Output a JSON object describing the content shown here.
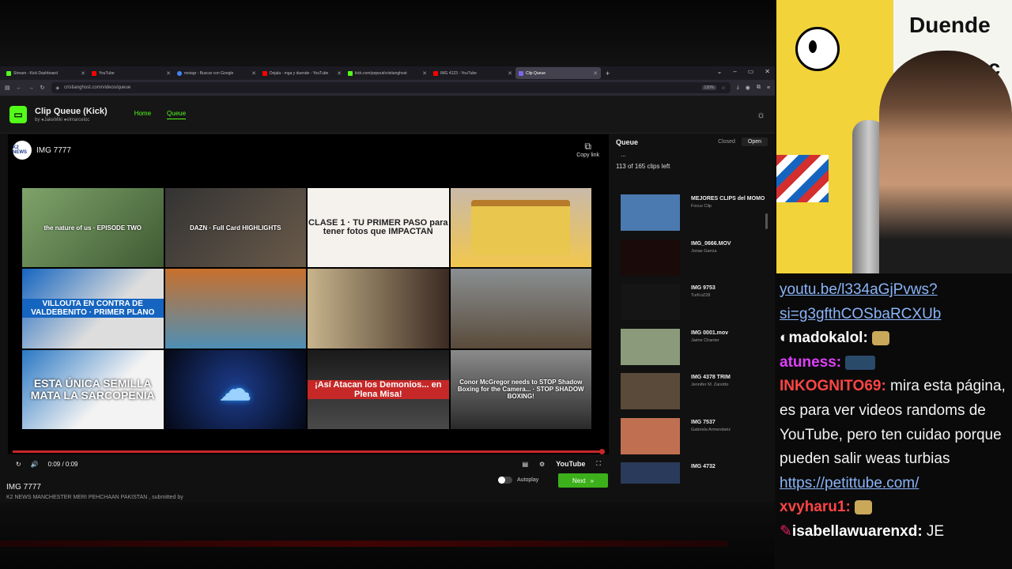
{
  "browser": {
    "tabs": [
      {
        "label": "Stream - Kick Dashboard",
        "color": "#53fc18"
      },
      {
        "label": "YouTube",
        "color": "#ff0000"
      },
      {
        "label": "moiagr - Buscar con Google",
        "color": "#4285f4"
      },
      {
        "label": "Dejala - mga y duende - YouTube",
        "color": "#ff0000"
      },
      {
        "label": "kick.com/popout/cristianghost",
        "color": "#53fc18"
      },
      {
        "label": "IMG 4123 - YouTube",
        "color": "#ff0000"
      },
      {
        "label": "Clip Queue",
        "color": "#7b68ee"
      }
    ],
    "new_tab": "+",
    "url": "cristianghost.com/videos/queue",
    "zoom": "130%"
  },
  "app": {
    "title": "Clip Queue (Kick)",
    "by": "by",
    "author1": "JakeMiki",
    "author2": "elmarceloc",
    "nav_home": "Home",
    "nav_queue": "Queue"
  },
  "player": {
    "channel_logo_text": "K2 NEWS",
    "title": "IMG 7777",
    "copy_link": "Copy link",
    "thumbnails": [
      {
        "text": "the nature of us · EPISODE TWO"
      },
      {
        "text": "DAZN · Full Card HIGHLIGHTS"
      },
      {
        "text": "CLASE 1 · TU PRIMER PASO para tener fotos que IMPACTAN"
      },
      {
        "text": ""
      },
      {
        "text": "VILLOUTA EN CONTRA DE VALDEBENITO · PRIMER PLANO"
      },
      {
        "text": ""
      },
      {
        "text": ""
      },
      {
        "text": ""
      },
      {
        "text": "ESTA ÚNICA SEMILLA MATA LA SARCOPENIA"
      },
      {
        "text": ""
      },
      {
        "text": "¡Así Atacan los Demonios... en Plena Misa!"
      },
      {
        "text": "Conor McGregor needs to STOP Shadow Boxing for the Camera... · STOP SHADOW BOXING!"
      }
    ],
    "time": "0:09 / 0:09",
    "youtube_label": "YouTube",
    "progress": 1.0
  },
  "below": {
    "title": "IMG 7777",
    "subtitle": "K2 NEWS MANCHESTER MERI PEHCHAAN PAKISTAN , submitted by",
    "autoplay": "Autoplay",
    "next": "Next"
  },
  "queue": {
    "title": "Queue",
    "closed": "Closed",
    "open": "Open",
    "dots": "...",
    "left": "113 of 165 clips left",
    "items": [
      {
        "title": "MEJORES CLIPS del MOMO",
        "author": "Focus Clip",
        "color": "#4a7ab0"
      },
      {
        "title": "IMG_0666.MOV",
        "author": "Jonas Garcia",
        "color": "#1a0a0a"
      },
      {
        "title": "IMG 9753",
        "author": "TurKoZ28",
        "color": "#0e0e0e"
      },
      {
        "title": "IMG 0001.mov",
        "author": "Jaime Chanter",
        "color": "#8a9a7a"
      },
      {
        "title": "IMG 4378 TRIM",
        "author": "Jennifer M. Zanotto",
        "color": "#5a4a3a"
      },
      {
        "title": "IMG 7537",
        "author": "Gabriela Armendariz",
        "color": "#c07050"
      },
      {
        "title": "IMG 4732",
        "author": "",
        "color": "#2a3a5a"
      }
    ]
  },
  "overlay": {
    "sign_text1": "Duende",
    "sign_text2": "ac"
  },
  "chat": {
    "lines": [
      {
        "user": "",
        "text": "youtu.be/l334aGjPvws?si=g3gfthCOSbaRCXUb",
        "link": true
      },
      {
        "user": "madokalol:",
        "text": "",
        "userclass": "u5"
      },
      {
        "user": "atuness:",
        "text": "",
        "userclass": "u2"
      },
      {
        "user": "INKOGNITO69:",
        "text": " mira esta página, es para ver videos randoms de YouTube, pero ten cuidao porque pueden salir weas turbias ",
        "userclass": "u3",
        "link_text": "https://petittube.com/"
      },
      {
        "user": "xvyharu1:",
        "text": "",
        "userclass": "u4"
      },
      {
        "user": "isabellawuarenxd:",
        "text": " JE",
        "userclass": "u5"
      }
    ]
  }
}
